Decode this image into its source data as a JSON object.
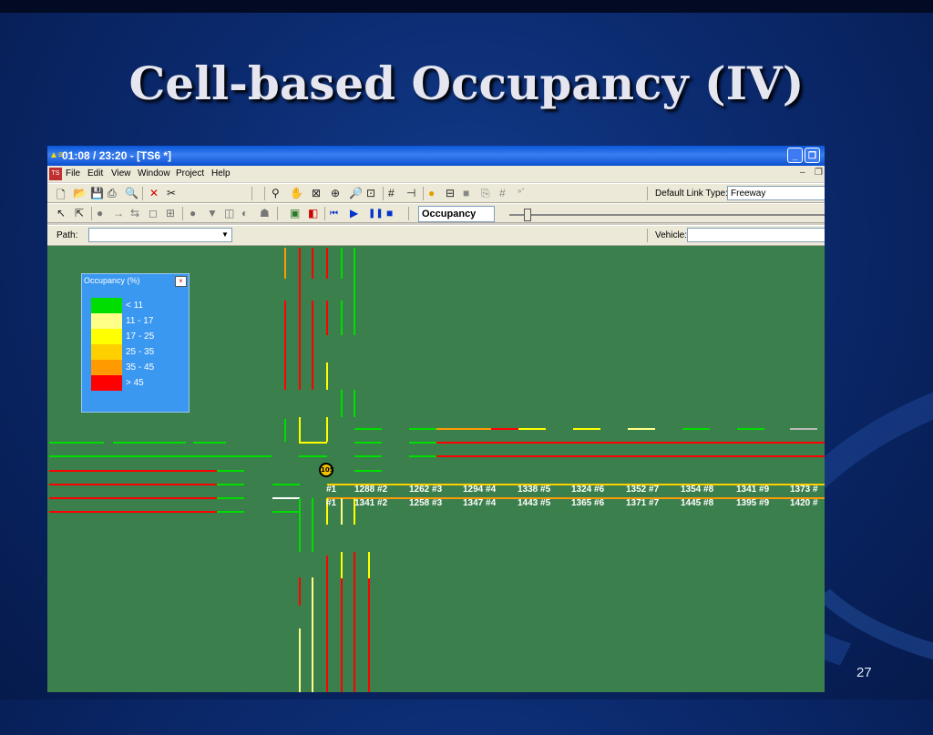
{
  "slide": {
    "title": "Cell-based Occupancy (IV)",
    "number": "27"
  },
  "window": {
    "title": "01:08 / 23:20 - [TS6 *]",
    "minimize": "_",
    "restore": "❐"
  },
  "menu": {
    "items": [
      "File",
      "Edit",
      "View",
      "Window",
      "Project",
      "Help"
    ]
  },
  "toolbar1": {
    "default_link_type_label": "Default Link Type:",
    "default_link_type_value": "Freeway"
  },
  "toolbar2": {
    "display_mode": "Occupancy"
  },
  "toolbar3": {
    "path_label": "Path:",
    "path_value": "",
    "vehicle_label": "Vehicle:",
    "vehicle_value": ""
  },
  "legend": {
    "title": "Occupancy (%)",
    "close": "×",
    "items": [
      {
        "label": "< 11",
        "color": "#00dd00"
      },
      {
        "label": "11 - 17",
        "color": "#ffff88"
      },
      {
        "label": "17 - 25",
        "color": "#ffff00"
      },
      {
        "label": "25 - 35",
        "color": "#ffd000"
      },
      {
        "label": "35 - 45",
        "color": "#ff9a00"
      },
      {
        "label": "> 45",
        "color": "#ff0000"
      }
    ]
  },
  "map": {
    "node_badge": "105",
    "upper_labels": [
      "#1",
      "1288 #2",
      "1262 #3",
      "1294 #4",
      "1338 #5",
      "1324 #6",
      "1352 #7",
      "1354 #8",
      "1341 #9",
      "1373 #"
    ],
    "lower_labels": [
      "#1",
      "1341 #2",
      "1258 #3",
      "1347 #4",
      "1443 #5",
      "1365 #6",
      "1371 #7",
      "1445 #8",
      "1395 #9",
      "1420 #"
    ]
  },
  "colors": {
    "map_background": "#3b7f4d",
    "slide_background": "#0b2a6e"
  }
}
